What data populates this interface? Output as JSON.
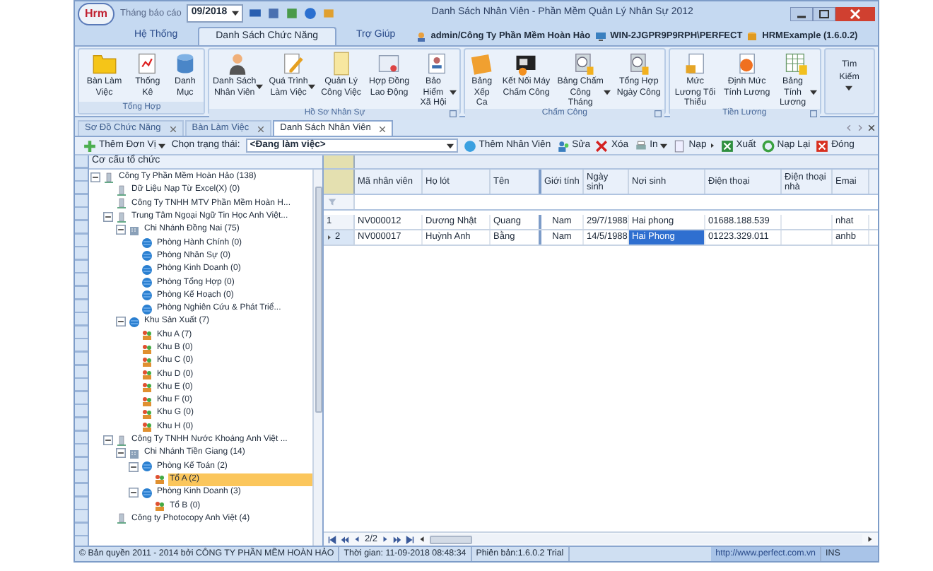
{
  "title_bar": {
    "logo": "Hrm",
    "period_label": "Tháng báo cáo",
    "period_value": "09/2018",
    "title": "Danh Sách Nhân Viên - Phần Mềm Quản Lý Nhân Sự 2012"
  },
  "menu_tabs": [
    {
      "label": "Hệ Thống",
      "selected": false
    },
    {
      "label": "Danh Sách Chức Năng",
      "selected": true
    },
    {
      "label": "Trợ Giúp",
      "selected": false
    }
  ],
  "session": {
    "user": "admin/Công Ty Phần Mềm Hoàn Hảo",
    "machine": "WIN-2JGPR9P9RPH\\PERFECT",
    "database": "HRMExample (1.6.0.2)"
  },
  "ribbon_groups": [
    {
      "title": "Tổng Hợp",
      "launcher": false,
      "items": [
        {
          "label": "Bàn Làm Việc",
          "dropdown": false
        },
        {
          "label": "Thống Kê",
          "dropdown": false
        },
        {
          "label": "Danh Mục",
          "dropdown": false
        }
      ]
    },
    {
      "title": "Hồ Sơ Nhân Sự",
      "launcher": true,
      "items": [
        {
          "label": "Danh Sách Nhân Viên",
          "dropdown": true
        },
        {
          "label": "Quá Trình Làm Việc",
          "dropdown": true
        },
        {
          "label": "Quản Lý Công Việc",
          "dropdown": false
        },
        {
          "label": "Hợp Đồng Lao Động",
          "dropdown": false
        },
        {
          "label": "Bảo Hiểm Xã Hội",
          "dropdown": true
        }
      ]
    },
    {
      "title": "Chấm Công",
      "launcher": true,
      "items": [
        {
          "label": "Bảng Xếp Ca",
          "dropdown": false
        },
        {
          "label": "Kết Nối Máy Chấm Công",
          "dropdown": false
        },
        {
          "label": "Bảng Chấm Công Tháng",
          "dropdown": true
        },
        {
          "label": "Tổng Hợp Ngày Công",
          "dropdown": false
        }
      ]
    },
    {
      "title": "Tiền Lương",
      "launcher": true,
      "items": [
        {
          "label": "Mức Lương Tối Thiểu",
          "dropdown": false
        },
        {
          "label": "Định Mức Tính Lương",
          "dropdown": false
        },
        {
          "label": "Bảng Tính Lương",
          "dropdown": true
        }
      ]
    }
  ],
  "search_button": {
    "label": "Tìm Kiếm",
    "dropdown": true
  },
  "doc_tabs": [
    {
      "label": "Sơ Đồ Chức Năng",
      "selected": false
    },
    {
      "label": "Bàn Làm Việc",
      "selected": false
    },
    {
      "label": "Danh Sách Nhân Viên",
      "selected": true
    }
  ],
  "toolbar": [
    {
      "kind": "button",
      "label": "Thêm Đơn Vị",
      "dropdown": true
    },
    {
      "kind": "label",
      "label": "Chọn trạng thái:"
    },
    {
      "kind": "combo",
      "label": "<Đang làm việc>"
    },
    {
      "kind": "button",
      "label": "Thêm Nhân Viên",
      "dropdown": false
    },
    {
      "kind": "button",
      "label": "Sửa",
      "dropdown": false
    },
    {
      "kind": "button",
      "label": "Xóa",
      "dropdown": false
    },
    {
      "kind": "button",
      "label": "In",
      "dropdown": true
    },
    {
      "kind": "button",
      "label": "Nạp",
      "dropdown": true
    },
    {
      "kind": "button",
      "label": "Xuất",
      "dropdown": false
    },
    {
      "kind": "button",
      "label": "Nạp Lại",
      "dropdown": false
    },
    {
      "kind": "button",
      "label": "Đóng",
      "dropdown": false
    }
  ],
  "tree": {
    "header": "Cơ cấu tổ chức",
    "nodes": [
      {
        "kind": "company",
        "label": "Công Ty Phần Mềm Hoàn Hảo (138)",
        "selected": false,
        "expanded": true,
        "children": [
          {
            "kind": "company",
            "label": "Dữ Liệu Nạp Từ Excel(X) (0)",
            "selected": false
          },
          {
            "kind": "company",
            "label": "Công Ty TNHH MTV Phần Mềm Hoàn H...",
            "selected": false
          },
          {
            "kind": "company",
            "label": "Trung Tâm Ngoại Ngữ Tin Học Anh Việt...",
            "selected": false,
            "expanded": true,
            "children": [
              {
                "kind": "branch",
                "label": "Chi Nhánh Đồng Nai (75)",
                "selected": false,
                "expanded": true,
                "children": [
                  {
                    "kind": "department",
                    "label": "Phòng Hành Chính (0)",
                    "selected": false
                  },
                  {
                    "kind": "department",
                    "label": "Phòng Nhân Sự (0)",
                    "selected": false
                  },
                  {
                    "kind": "department",
                    "label": "Phòng Kinh Doanh (0)",
                    "selected": false
                  },
                  {
                    "kind": "department",
                    "label": "Phòng Tổng Hợp (0)",
                    "selected": false
                  },
                  {
                    "kind": "department",
                    "label": "Phòng Kế Hoạch (0)",
                    "selected": false
                  },
                  {
                    "kind": "department",
                    "label": "Phòng Nghiên Cứu & Phát Triể...",
                    "selected": false
                  }
                ]
              },
              {
                "kind": "department",
                "label": "Khu Sản Xuất (7)",
                "selected": false,
                "expanded": true,
                "children": [
                  {
                    "kind": "team",
                    "label": "Khu A (7)",
                    "selected": false
                  },
                  {
                    "kind": "team",
                    "label": "Khu B (0)",
                    "selected": false
                  },
                  {
                    "kind": "team",
                    "label": "Khu C (0)",
                    "selected": false
                  },
                  {
                    "kind": "team",
                    "label": "Khu D (0)",
                    "selected": false
                  },
                  {
                    "kind": "team",
                    "label": "Khu E (0)",
                    "selected": false
                  },
                  {
                    "kind": "team",
                    "label": "Khu F (0)",
                    "selected": false
                  },
                  {
                    "kind": "team",
                    "label": "Khu G (0)",
                    "selected": false
                  },
                  {
                    "kind": "team",
                    "label": "Khu H (0)",
                    "selected": false
                  }
                ]
              }
            ]
          },
          {
            "kind": "company",
            "label": "Công Ty TNHH Nước Khoáng Anh Việt ...",
            "selected": false,
            "expanded": true,
            "children": [
              {
                "kind": "branch",
                "label": "Chi Nhánh Tiền Giang (14)",
                "selected": false,
                "expanded": true,
                "children": [
                  {
                    "kind": "department",
                    "label": "Phòng Kế Toán (2)",
                    "selected": false,
                    "expanded": true,
                    "children": [
                      {
                        "kind": "team",
                        "label": "Tổ A (2)",
                        "selected": true
                      }
                    ]
                  },
                  {
                    "kind": "department",
                    "label": "Phòng Kinh Doanh (3)",
                    "selected": false,
                    "expanded": true,
                    "children": [
                      {
                        "kind": "team",
                        "label": "Tổ B (0)",
                        "selected": false
                      }
                    ]
                  }
                ]
              }
            ]
          },
          {
            "kind": "company",
            "label": "Công ty Photocopy Anh Việt (4)",
            "selected": false
          }
        ]
      }
    ]
  },
  "grid": {
    "columns": [
      "Mã nhân viên",
      "Họ lót",
      "Tên",
      "Giới tính",
      "Ngày sinh",
      "Nơi sinh",
      "Điện thoại",
      "Điện thoại nhà",
      "Emai"
    ],
    "rows": [
      {
        "number": "1",
        "current": false,
        "cells": [
          {
            "text": "NV000012",
            "selected": false
          },
          {
            "text": "Dương Nhật",
            "selected": false
          },
          {
            "text": "Quang",
            "selected": false
          },
          {
            "text": "Nam",
            "selected": false
          },
          {
            "text": "29/7/1988",
            "selected": false
          },
          {
            "text": "Hai phong",
            "selected": false
          },
          {
            "text": "01688.188.539",
            "selected": false
          },
          {
            "selected": false
          },
          {
            "text": "nhat",
            "selected": false
          }
        ]
      },
      {
        "number": "2",
        "current": true,
        "cells": [
          {
            "text": "NV000017",
            "selected": false
          },
          {
            "text": "Huỳnh Anh",
            "selected": false
          },
          {
            "text": "Bằng",
            "selected": false
          },
          {
            "text": "Nam",
            "selected": false
          },
          {
            "text": "14/5/1988",
            "selected": false
          },
          {
            "text": "Hai Phong",
            "selected": true
          },
          {
            "text": "01223.329.011",
            "selected": false
          },
          {
            "selected": false
          },
          {
            "text": "anhb",
            "selected": false
          }
        ]
      }
    ],
    "pager": "2/2"
  },
  "status_bar": {
    "copyright": "© Bản quyền 2011 - 2014 bởi CÔNG TY PHẦN MỀM HOÀN HẢO",
    "time": "Thời gian: 11-09-2018 08:48:34",
    "version": "Phiên bản:1.6.0.2 Trial",
    "url": "http://www.perfect.com.vn",
    "mode": "INS"
  }
}
